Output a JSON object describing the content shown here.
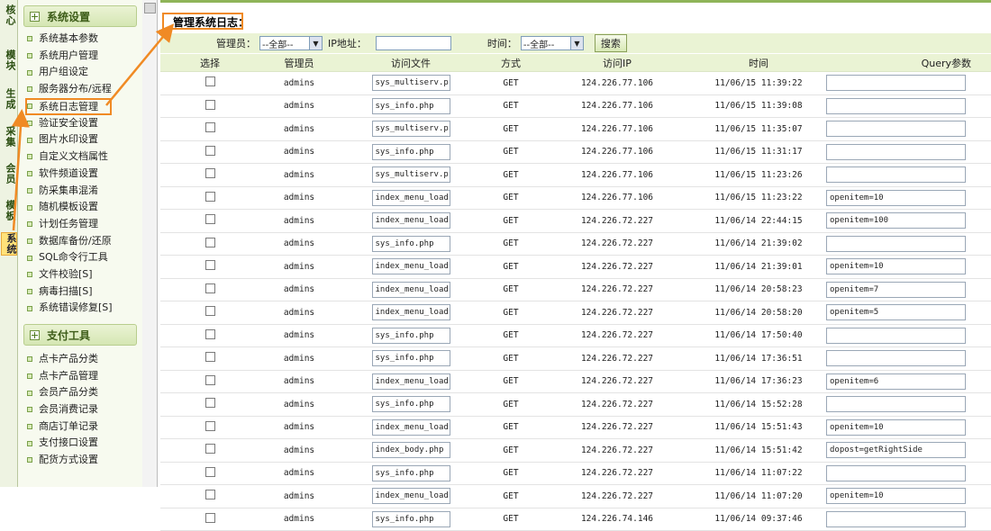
{
  "vtabs": [
    "核心",
    "模块",
    "生成",
    "采集",
    "会员",
    "模板",
    "系统"
  ],
  "sidebar": {
    "section1": {
      "title": "系统设置",
      "items": [
        "系统基本参数",
        "系统用户管理",
        "用户组设定",
        "服务器分布/远程",
        "系统日志管理",
        "验证安全设置",
        "图片水印设置",
        "自定义文档属性",
        "软件频道设置",
        "防采集串混淆",
        "随机模板设置",
        "计划任务管理",
        "数据库备份/还原",
        "SQL命令行工具",
        "文件校验[S]",
        "病毒扫描[S]",
        "系统错误修复[S]"
      ]
    },
    "section2": {
      "title": "支付工具",
      "items": [
        "点卡产品分类",
        "点卡产品管理",
        "会员产品分类",
        "会员消费记录",
        "商店订单记录",
        "支付接口设置",
        "配货方式设置"
      ]
    }
  },
  "main": {
    "title": "管理系统日志：",
    "filter": {
      "admin_label": "管理员：",
      "admin_value": "--全部--",
      "ip_label": "IP地址：",
      "ip_value": "",
      "time_label": "时间：",
      "time_value": "--全部--",
      "search_label": "搜索"
    },
    "columns": [
      "选择",
      "管理员",
      "访问文件",
      "方式",
      "访问IP",
      "时间",
      "Query参数"
    ],
    "rows": [
      {
        "admin": "admins",
        "file": "sys_multiserv.p",
        "method": "GET",
        "ip": "124.226.77.106",
        "time": "11/06/15 11:39:22",
        "query": ""
      },
      {
        "admin": "admins",
        "file": "sys_info.php",
        "method": "GET",
        "ip": "124.226.77.106",
        "time": "11/06/15 11:39:08",
        "query": ""
      },
      {
        "admin": "admins",
        "file": "sys_multiserv.p",
        "method": "GET",
        "ip": "124.226.77.106",
        "time": "11/06/15 11:35:07",
        "query": ""
      },
      {
        "admin": "admins",
        "file": "sys_info.php",
        "method": "GET",
        "ip": "124.226.77.106",
        "time": "11/06/15 11:31:17",
        "query": ""
      },
      {
        "admin": "admins",
        "file": "sys_multiserv.p",
        "method": "GET",
        "ip": "124.226.77.106",
        "time": "11/06/15 11:23:26",
        "query": ""
      },
      {
        "admin": "admins",
        "file": "index_menu_load",
        "method": "GET",
        "ip": "124.226.77.106",
        "time": "11/06/15 11:23:22",
        "query": "openitem=10"
      },
      {
        "admin": "admins",
        "file": "index_menu_load",
        "method": "GET",
        "ip": "124.226.72.227",
        "time": "11/06/14 22:44:15",
        "query": "openitem=100"
      },
      {
        "admin": "admins",
        "file": "sys_info.php",
        "method": "GET",
        "ip": "124.226.72.227",
        "time": "11/06/14 21:39:02",
        "query": ""
      },
      {
        "admin": "admins",
        "file": "index_menu_load",
        "method": "GET",
        "ip": "124.226.72.227",
        "time": "11/06/14 21:39:01",
        "query": "openitem=10"
      },
      {
        "admin": "admins",
        "file": "index_menu_load",
        "method": "GET",
        "ip": "124.226.72.227",
        "time": "11/06/14 20:58:23",
        "query": "openitem=7"
      },
      {
        "admin": "admins",
        "file": "index_menu_load",
        "method": "GET",
        "ip": "124.226.72.227",
        "time": "11/06/14 20:58:20",
        "query": "openitem=5"
      },
      {
        "admin": "admins",
        "file": "sys_info.php",
        "method": "GET",
        "ip": "124.226.72.227",
        "time": "11/06/14 17:50:40",
        "query": ""
      },
      {
        "admin": "admins",
        "file": "sys_info.php",
        "method": "GET",
        "ip": "124.226.72.227",
        "time": "11/06/14 17:36:51",
        "query": ""
      },
      {
        "admin": "admins",
        "file": "index_menu_load",
        "method": "GET",
        "ip": "124.226.72.227",
        "time": "11/06/14 17:36:23",
        "query": "openitem=6"
      },
      {
        "admin": "admins",
        "file": "sys_info.php",
        "method": "GET",
        "ip": "124.226.72.227",
        "time": "11/06/14 15:52:28",
        "query": ""
      },
      {
        "admin": "admins",
        "file": "index_menu_load",
        "method": "GET",
        "ip": "124.226.72.227",
        "time": "11/06/14 15:51:43",
        "query": "openitem=10"
      },
      {
        "admin": "admins",
        "file": "index_body.php",
        "method": "GET",
        "ip": "124.226.72.227",
        "time": "11/06/14 15:51:42",
        "query": "dopost=getRightSide"
      },
      {
        "admin": "admins",
        "file": "sys_info.php",
        "method": "GET",
        "ip": "124.226.72.227",
        "time": "11/06/14 11:07:22",
        "query": ""
      },
      {
        "admin": "admins",
        "file": "index_menu_load",
        "method": "GET",
        "ip": "124.226.72.227",
        "time": "11/06/14 11:07:20",
        "query": "openitem=10"
      },
      {
        "admin": "admins",
        "file": "sys_info.php",
        "method": "GET",
        "ip": "124.226.74.146",
        "time": "11/06/14 09:37:46",
        "query": ""
      }
    ]
  },
  "colors": {
    "accent_green": "#8fb459",
    "highlight_orange": "#f08a24",
    "header_bg": "#eaf3d4"
  },
  "icons": {
    "section_toggle": "plus-box-icon",
    "list_bullet": "square-bullet-icon",
    "dropdown": "triangle-down-icon",
    "checkbox": "checkbox-icon"
  }
}
